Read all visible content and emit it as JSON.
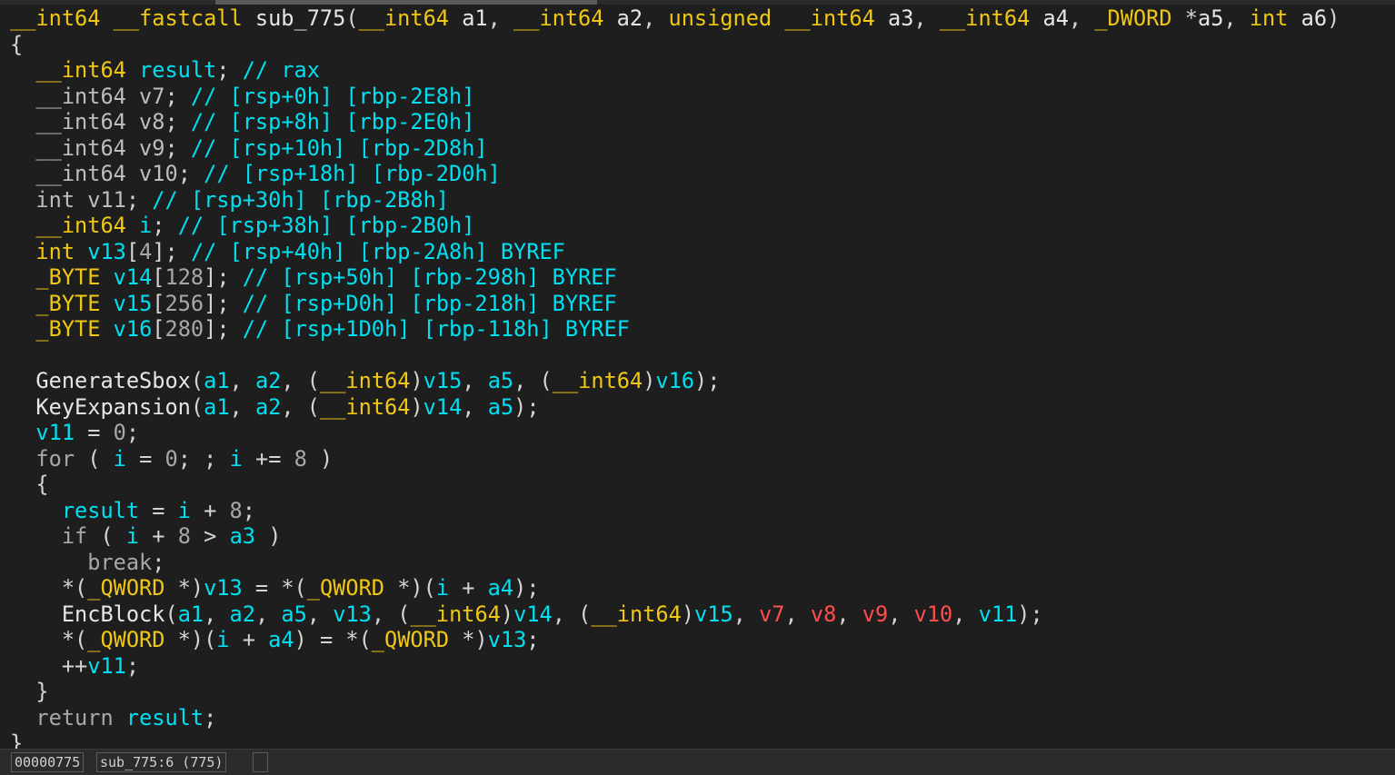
{
  "code_lines": [
    [
      [
        "k",
        "__int64 __fastcall "
      ],
      [
        "f",
        "sub_775"
      ],
      [
        "d",
        "("
      ],
      [
        "k",
        "__int64 "
      ],
      [
        "f",
        "a1"
      ],
      [
        "d",
        ", "
      ],
      [
        "k",
        "__int64 "
      ],
      [
        "f",
        "a2"
      ],
      [
        "d",
        ", "
      ],
      [
        "k",
        "unsigned __int64 "
      ],
      [
        "f",
        "a3"
      ],
      [
        "d",
        ", "
      ],
      [
        "k",
        "__int64 "
      ],
      [
        "f",
        "a4"
      ],
      [
        "d",
        ", "
      ],
      [
        "k",
        "_DWORD "
      ],
      [
        "d",
        "*"
      ],
      [
        "f",
        "a5"
      ],
      [
        "d",
        ", "
      ],
      [
        "k",
        "int "
      ],
      [
        "f",
        "a6"
      ],
      [
        "d",
        ")"
      ]
    ],
    [
      [
        "d",
        "{"
      ]
    ],
    [
      [
        "d",
        "  "
      ],
      [
        "k",
        "__int64 "
      ],
      [
        "v",
        "result"
      ],
      [
        "d",
        "; "
      ],
      [
        "v",
        "// rax"
      ]
    ],
    [
      [
        "d",
        "  "
      ],
      [
        "l",
        "__int64 v7"
      ],
      [
        "d",
        "; "
      ],
      [
        "v",
        "// [rsp+0h] [rbp-2E8h]"
      ]
    ],
    [
      [
        "d",
        "  "
      ],
      [
        "l",
        "__int64 v8"
      ],
      [
        "d",
        "; "
      ],
      [
        "v",
        "// [rsp+8h] [rbp-2E0h]"
      ]
    ],
    [
      [
        "d",
        "  "
      ],
      [
        "l",
        "__int64 v9"
      ],
      [
        "d",
        "; "
      ],
      [
        "v",
        "// [rsp+10h] [rbp-2D8h]"
      ]
    ],
    [
      [
        "d",
        "  "
      ],
      [
        "l",
        "__int64 v10"
      ],
      [
        "d",
        "; "
      ],
      [
        "v",
        "// [rsp+18h] [rbp-2D0h]"
      ]
    ],
    [
      [
        "d",
        "  "
      ],
      [
        "l",
        "int v11"
      ],
      [
        "d",
        "; "
      ],
      [
        "v",
        "// [rsp+30h] [rbp-2B8h]"
      ]
    ],
    [
      [
        "d",
        "  "
      ],
      [
        "k",
        "__int64 "
      ],
      [
        "v",
        "i"
      ],
      [
        "d",
        "; "
      ],
      [
        "v",
        "// [rsp+38h] [rbp-2B0h]"
      ]
    ],
    [
      [
        "d",
        "  "
      ],
      [
        "k",
        "int "
      ],
      [
        "v",
        "v13"
      ],
      [
        "d",
        "["
      ],
      [
        "g",
        "4"
      ],
      [
        "d",
        "]; "
      ],
      [
        "v",
        "// [rsp+40h] [rbp-2A8h] BYREF"
      ]
    ],
    [
      [
        "d",
        "  "
      ],
      [
        "k",
        "_BYTE "
      ],
      [
        "v",
        "v14"
      ],
      [
        "d",
        "["
      ],
      [
        "g",
        "128"
      ],
      [
        "d",
        "]; "
      ],
      [
        "v",
        "// [rsp+50h] [rbp-298h] BYREF"
      ]
    ],
    [
      [
        "d",
        "  "
      ],
      [
        "k",
        "_BYTE "
      ],
      [
        "v",
        "v15"
      ],
      [
        "d",
        "["
      ],
      [
        "g",
        "256"
      ],
      [
        "d",
        "]; "
      ],
      [
        "v",
        "// [rsp+D0h] [rbp-218h] BYREF"
      ]
    ],
    [
      [
        "d",
        "  "
      ],
      [
        "k",
        "_BYTE "
      ],
      [
        "v",
        "v16"
      ],
      [
        "d",
        "["
      ],
      [
        "g",
        "280"
      ],
      [
        "d",
        "]; "
      ],
      [
        "v",
        "// [rsp+1D0h] [rbp-118h] BYREF"
      ]
    ],
    [
      [
        "d",
        " "
      ]
    ],
    [
      [
        "d",
        "  "
      ],
      [
        "f",
        "GenerateSbox"
      ],
      [
        "d",
        "("
      ],
      [
        "v",
        "a1"
      ],
      [
        "d",
        ", "
      ],
      [
        "v",
        "a2"
      ],
      [
        "d",
        ", ("
      ],
      [
        "k",
        "__int64"
      ],
      [
        "d",
        ")"
      ],
      [
        "v",
        "v15"
      ],
      [
        "d",
        ", "
      ],
      [
        "v",
        "a5"
      ],
      [
        "d",
        ", ("
      ],
      [
        "k",
        "__int64"
      ],
      [
        "d",
        ")"
      ],
      [
        "v",
        "v16"
      ],
      [
        "d",
        ");"
      ]
    ],
    [
      [
        "d",
        "  "
      ],
      [
        "f",
        "KeyExpansion"
      ],
      [
        "d",
        "("
      ],
      [
        "v",
        "a1"
      ],
      [
        "d",
        ", "
      ],
      [
        "v",
        "a2"
      ],
      [
        "d",
        ", ("
      ],
      [
        "k",
        "__int64"
      ],
      [
        "d",
        ")"
      ],
      [
        "v",
        "v14"
      ],
      [
        "d",
        ", "
      ],
      [
        "v",
        "a5"
      ],
      [
        "d",
        ");"
      ]
    ],
    [
      [
        "d",
        "  "
      ],
      [
        "v",
        "v11"
      ],
      [
        "d",
        " = "
      ],
      [
        "g",
        "0"
      ],
      [
        "d",
        ";"
      ]
    ],
    [
      [
        "d",
        "  "
      ],
      [
        "g",
        "for"
      ],
      [
        "d",
        " ( "
      ],
      [
        "v",
        "i"
      ],
      [
        "d",
        " = "
      ],
      [
        "g",
        "0"
      ],
      [
        "d",
        "; ; "
      ],
      [
        "v",
        "i"
      ],
      [
        "d",
        " += "
      ],
      [
        "g",
        "8"
      ],
      [
        "d",
        " )"
      ]
    ],
    [
      [
        "d",
        "  {"
      ]
    ],
    [
      [
        "d",
        "    "
      ],
      [
        "v",
        "result"
      ],
      [
        "d",
        " = "
      ],
      [
        "v",
        "i"
      ],
      [
        "d",
        " + "
      ],
      [
        "g",
        "8"
      ],
      [
        "d",
        ";"
      ]
    ],
    [
      [
        "d",
        "    "
      ],
      [
        "g",
        "if"
      ],
      [
        "d",
        " ( "
      ],
      [
        "v",
        "i"
      ],
      [
        "d",
        " + "
      ],
      [
        "g",
        "8"
      ],
      [
        "d",
        " > "
      ],
      [
        "v",
        "a3"
      ],
      [
        "d",
        " )"
      ]
    ],
    [
      [
        "d",
        "      "
      ],
      [
        "g",
        "break"
      ],
      [
        "d",
        ";"
      ]
    ],
    [
      [
        "d",
        "    *("
      ],
      [
        "k",
        "_QWORD "
      ],
      [
        "d",
        "*)"
      ],
      [
        "v",
        "v13"
      ],
      [
        "d",
        " = *("
      ],
      [
        "k",
        "_QWORD "
      ],
      [
        "d",
        "*)("
      ],
      [
        "v",
        "i"
      ],
      [
        "d",
        " + "
      ],
      [
        "v",
        "a4"
      ],
      [
        "d",
        ");"
      ]
    ],
    [
      [
        "d",
        "    "
      ],
      [
        "f",
        "EncBlock"
      ],
      [
        "d",
        "("
      ],
      [
        "v",
        "a1"
      ],
      [
        "d",
        ", "
      ],
      [
        "v",
        "a2"
      ],
      [
        "d",
        ", "
      ],
      [
        "v",
        "a5"
      ],
      [
        "d",
        ", "
      ],
      [
        "v",
        "v13"
      ],
      [
        "d",
        ", ("
      ],
      [
        "k",
        "__int64"
      ],
      [
        "d",
        ")"
      ],
      [
        "v",
        "v14"
      ],
      [
        "d",
        ", ("
      ],
      [
        "k",
        "__int64"
      ],
      [
        "d",
        ")"
      ],
      [
        "v",
        "v15"
      ],
      [
        "d",
        ", "
      ],
      [
        "r",
        "v7"
      ],
      [
        "d",
        ", "
      ],
      [
        "r",
        "v8"
      ],
      [
        "d",
        ", "
      ],
      [
        "r",
        "v9"
      ],
      [
        "d",
        ", "
      ],
      [
        "r",
        "v10"
      ],
      [
        "d",
        ", "
      ],
      [
        "v",
        "v11"
      ],
      [
        "d",
        ");"
      ]
    ],
    [
      [
        "d",
        "    *("
      ],
      [
        "k",
        "_QWORD "
      ],
      [
        "d",
        "*)("
      ],
      [
        "v",
        "i"
      ],
      [
        "d",
        " + "
      ],
      [
        "v",
        "a4"
      ],
      [
        "d",
        ") = *("
      ],
      [
        "k",
        "_QWORD "
      ],
      [
        "d",
        "*)"
      ],
      [
        "v",
        "v13"
      ],
      [
        "d",
        ";"
      ]
    ],
    [
      [
        "d",
        "    ++"
      ],
      [
        "v",
        "v11"
      ],
      [
        "d",
        ";"
      ]
    ],
    [
      [
        "d",
        "  }"
      ]
    ],
    [
      [
        "d",
        "  "
      ],
      [
        "g",
        "return "
      ],
      [
        "v",
        "result"
      ],
      [
        "d",
        ";"
      ]
    ],
    [
      [
        "d",
        "}"
      ]
    ]
  ],
  "highlighted_line": 5,
  "status": {
    "address": "00000775",
    "location": "sub_775:6 (775)",
    "extra": ""
  },
  "colors": {
    "background": "#1e1e1e",
    "keyword": "#f0c814",
    "variable": "#00e0f0",
    "error_var": "#ff4d4d",
    "punct": "#d4d4d4",
    "number": "#a8a8a8"
  }
}
